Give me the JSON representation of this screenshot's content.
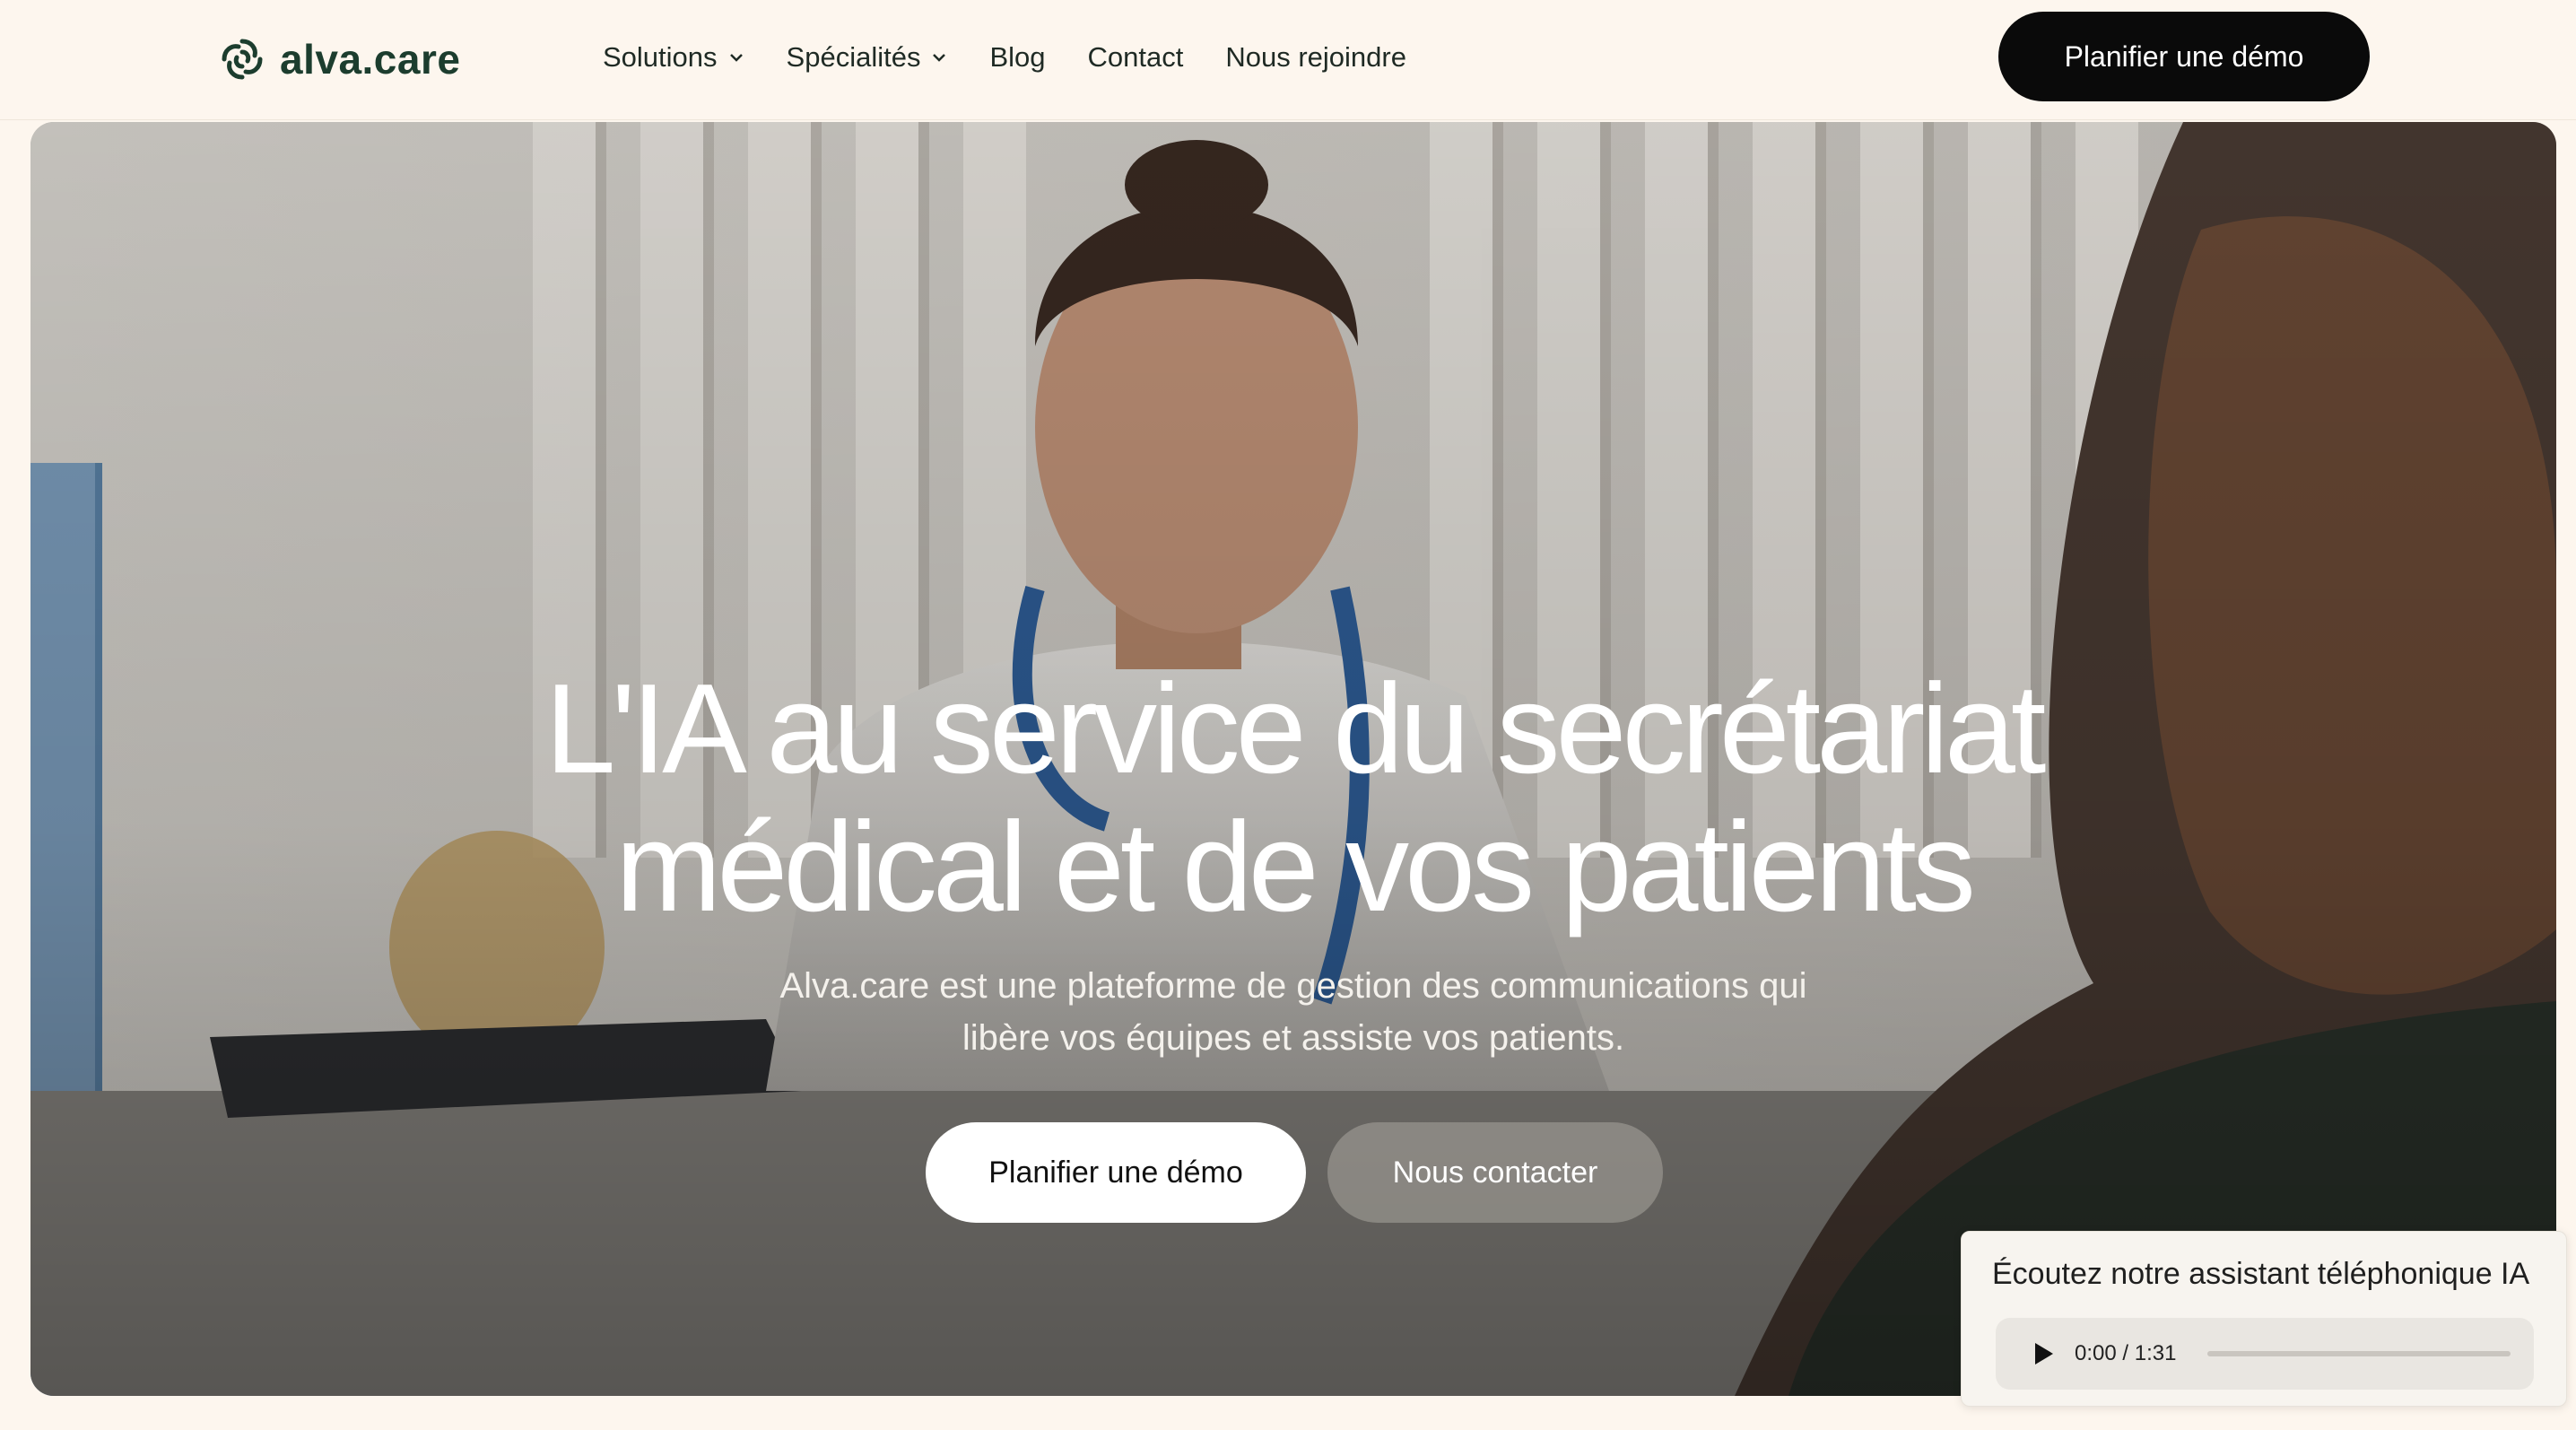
{
  "header": {
    "logo_text": "alva.care",
    "nav": [
      {
        "label": "Solutions",
        "has_dropdown": true
      },
      {
        "label": "Spécialités",
        "has_dropdown": true
      },
      {
        "label": "Blog",
        "has_dropdown": false
      },
      {
        "label": "Contact",
        "has_dropdown": false
      },
      {
        "label": "Nous rejoindre",
        "has_dropdown": false
      }
    ],
    "cta_label": "Planifier une démo"
  },
  "hero": {
    "title_line1": "L'IA au service du secrétariat",
    "title_line2": "médical et de vos patients",
    "subtitle_line1": "Alva.care est une plateforme de gestion des communications qui",
    "subtitle_line2": "libère vos équipes et assiste vos patients.",
    "primary_button": "Planifier une démo",
    "secondary_button": "Nous contacter"
  },
  "audio_widget": {
    "title": "Écoutez notre assistant téléphonique IA",
    "time": "0:00 / 1:31",
    "progress": 0
  },
  "colors": {
    "background": "#fdf6ee",
    "brand_green": "#1c3d2e",
    "cta_black": "#0a0a0a"
  },
  "icons": [
    "alva-logo-icon",
    "chevron-down-icon",
    "play-icon"
  ]
}
